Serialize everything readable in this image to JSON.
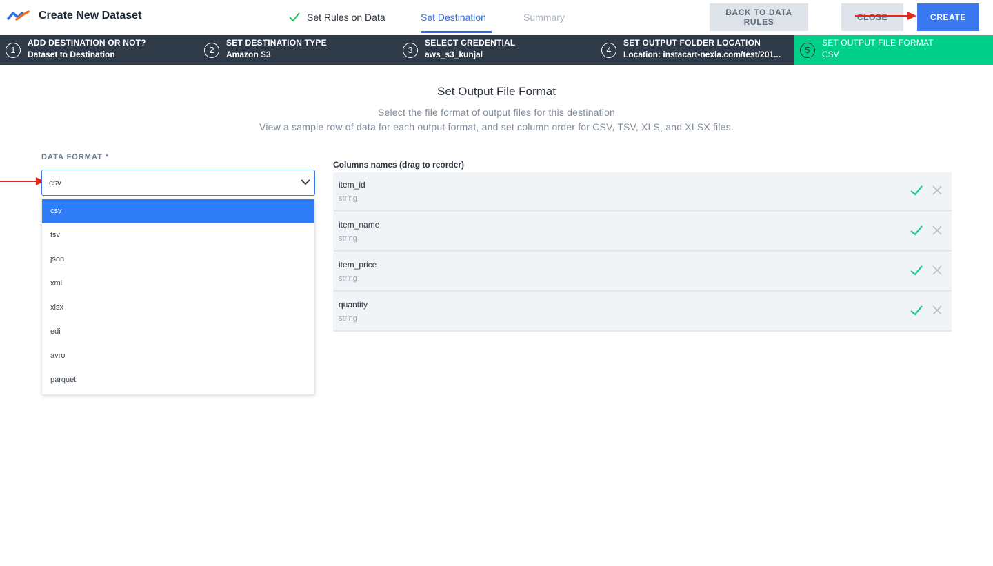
{
  "header": {
    "app_title": "Create New Dataset",
    "tabs": [
      {
        "label": "Set Rules on Data",
        "state": "completed",
        "icon": "check-icon"
      },
      {
        "label": "Set Destination",
        "state": "active"
      },
      {
        "label": "Summary",
        "state": "inactive"
      }
    ],
    "buttons": {
      "back": "BACK TO DATA RULES",
      "close": "CLOSE",
      "create": "CREATE"
    },
    "colors": {
      "accent": "#2f6ee8",
      "create_button": "#3a78f2",
      "completed_check": "#22c55e"
    }
  },
  "stepper": {
    "steps": [
      {
        "number": "1",
        "title": "ADD DESTINATION OR NOT?",
        "value": "Dataset to Destination"
      },
      {
        "number": "2",
        "title": "SET DESTINATION TYPE",
        "value": "Amazon S3"
      },
      {
        "number": "3",
        "title": "SELECT CREDENTIAL",
        "value": "aws_s3_kunjal"
      },
      {
        "number": "4",
        "title": "SET OUTPUT FOLDER LOCATION",
        "value": "Location: instacart-nexla.com/test/201..."
      },
      {
        "number": "5",
        "title": "SET OUTPUT FILE FORMAT",
        "value": "CSV",
        "state": "active"
      }
    ],
    "colors": {
      "background": "#2e3a47",
      "active": "#00d08a"
    }
  },
  "main": {
    "heading": "Set Output File Format",
    "subtitle_1": "Select the file format of output files for this destination",
    "subtitle_2": "View a sample row of data for each output format, and set column order for CSV, TSV, XLS, and XLSX files."
  },
  "data_format": {
    "label": "DATA FORMAT *",
    "selected": "csv",
    "options": [
      "csv",
      "tsv",
      "json",
      "xml",
      "xlsx",
      "edi",
      "avro",
      "parquet"
    ],
    "highlighted_option": "csv"
  },
  "columns": {
    "label": "Columns names (drag to reorder)",
    "items": [
      {
        "name": "item_id",
        "type": "string"
      },
      {
        "name": "item_name",
        "type": "string"
      },
      {
        "name": "item_price",
        "type": "string"
      },
      {
        "name": "quantity",
        "type": "string"
      }
    ],
    "icons": {
      "include": "check-icon",
      "remove": "x-icon"
    },
    "colors": {
      "check": "#1fc98a",
      "x": "#b9c1ca"
    }
  }
}
